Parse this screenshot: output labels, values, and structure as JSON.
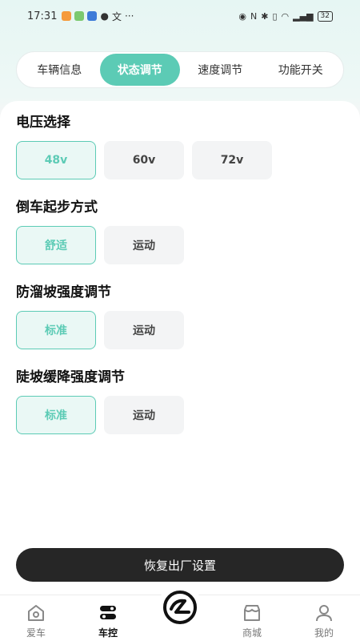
{
  "status_bar": {
    "time": "17:31",
    "battery": "32"
  },
  "tabs": [
    {
      "label": "车辆信息"
    },
    {
      "label": "状态调节"
    },
    {
      "label": "速度调节"
    },
    {
      "label": "功能开关"
    }
  ],
  "sections": [
    {
      "title": "电压选择",
      "options": [
        "48v",
        "60v",
        "72v"
      ],
      "selected": 0
    },
    {
      "title": "倒车起步方式",
      "options": [
        "舒适",
        "运动"
      ],
      "selected": 0
    },
    {
      "title": "防溜坡强度调节",
      "options": [
        "标准",
        "运动"
      ],
      "selected": 0
    },
    {
      "title": "陡坡缓降强度调节",
      "options": [
        "标准",
        "运动"
      ],
      "selected": 0
    }
  ],
  "reset_button": "恢复出厂设置",
  "nav": [
    {
      "label": "爱车",
      "icon": "car-home-icon"
    },
    {
      "label": "车控",
      "icon": "toggle-control-icon"
    },
    {
      "label": "",
      "icon": "brand-logo-icon"
    },
    {
      "label": "商城",
      "icon": "shop-icon"
    },
    {
      "label": "我的",
      "icon": "profile-icon"
    }
  ],
  "colors": {
    "accent": "#5ccbb5",
    "dark_button": "#262626"
  }
}
